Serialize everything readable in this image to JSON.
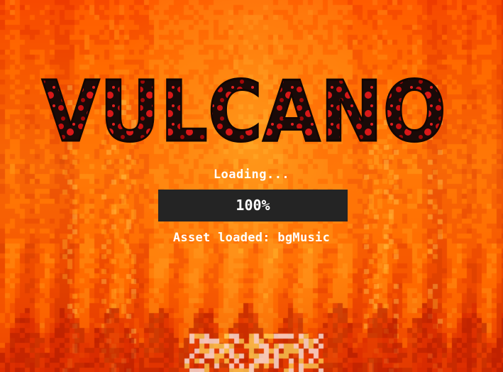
{
  "game": {
    "title": "VULCANO",
    "loading_label": "Loading...",
    "progress_percent": 100,
    "progress_label": "100%",
    "status_text": "Asset loaded: bgMusic"
  },
  "theme": {
    "fire_dark": "#e03000",
    "fire_mid": "#ff6a00",
    "fire_light": "#ffb020",
    "fire_hot": "#ffe060",
    "logo_fill": "#1a0a08",
    "logo_spots": "#d01010",
    "progress_bg": "#242424",
    "text_color": "#ffffff"
  }
}
